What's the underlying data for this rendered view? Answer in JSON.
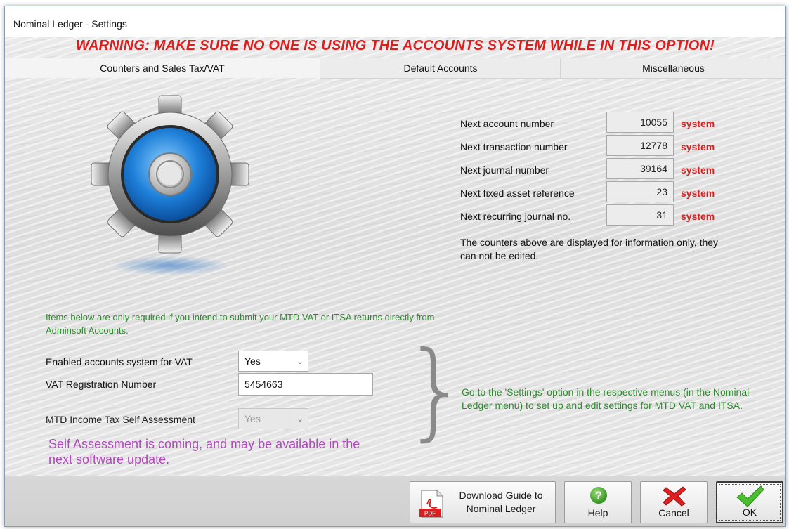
{
  "window": {
    "title": "Nominal Ledger  -  Settings"
  },
  "warning": "WARNING:  MAKE SURE NO ONE IS USING THE ACCOUNTS SYSTEM WHILE IN THIS OPTION!",
  "tabs": [
    {
      "label": "Counters and Sales Tax/VAT",
      "active": true
    },
    {
      "label": "Default Accounts",
      "active": false
    },
    {
      "label": "Miscellaneous",
      "active": false
    }
  ],
  "counters": [
    {
      "label": "Next account number",
      "value": "10055",
      "tag": "system"
    },
    {
      "label": "Next transaction number",
      "value": "12778",
      "tag": "system"
    },
    {
      "label": "Next journal number",
      "value": "39164",
      "tag": "system"
    },
    {
      "label": "Next fixed asset reference",
      "value": "23",
      "tag": "system"
    },
    {
      "label": "Next recurring journal no.",
      "value": "31",
      "tag": "system"
    }
  ],
  "counters_note": "The counters above are displayed for information only, they can not be edited.",
  "mtd": {
    "intro": "Items below are only required if you intend to submit your MTD VAT or ITSA returns directly from Adminsoft Accounts.",
    "vat_enabled_label": "Enabled accounts system for VAT",
    "vat_enabled_value": "Yes",
    "vat_reg_label": "VAT Registration Number",
    "vat_reg_value": "5454663",
    "itsa_label": "MTD Income Tax Self Assessment",
    "itsa_value": "Yes",
    "settings_note": "Go to the 'Settings' option in the respective menus (in the Nominal Ledger menu) to set up and edit settings for MTD VAT and ITSA.",
    "sa_note": "Self Assessment is coming, and may be available in the next software update."
  },
  "buttons": {
    "guide": "Download Guide to Nominal Ledger",
    "pdf_badge": "PDF",
    "help": "Help",
    "cancel": "Cancel",
    "ok": "OK"
  },
  "colors": {
    "warning": "#e21b1b",
    "system_tag": "#d42020",
    "info_green": "#2e8b2e",
    "sa_purple": "#b04aba"
  }
}
